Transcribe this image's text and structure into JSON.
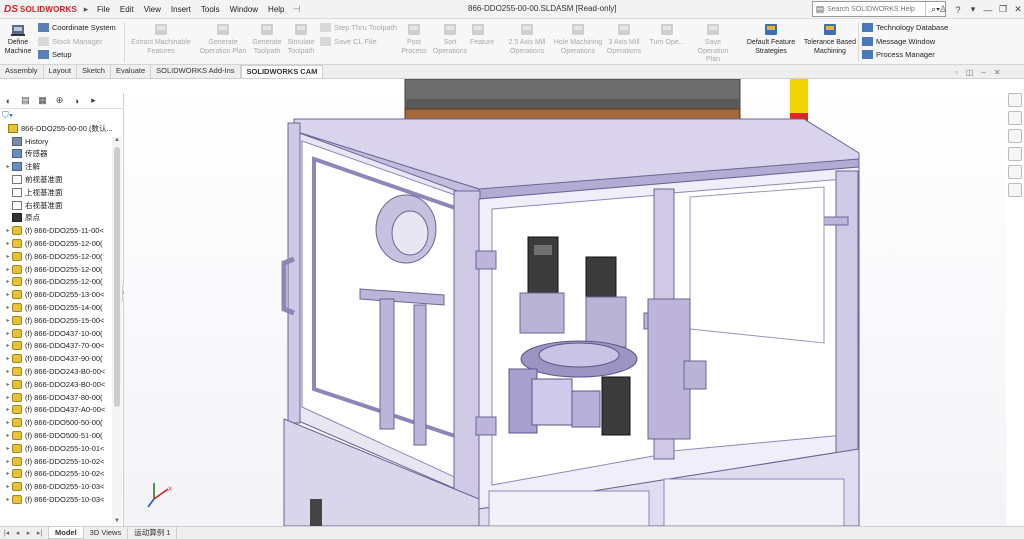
{
  "app": {
    "brand": "SOLIDWORKS",
    "brand_prefix": "DS",
    "document_title": "866-DDO255-00-00.SLDASM [Read-only]",
    "menus": [
      "File",
      "Edit",
      "View",
      "Insert",
      "Tools",
      "Window",
      "Help"
    ],
    "search_placeholder": "Search SOLIDWORKS Help"
  },
  "ribbon": {
    "define_machine": "Define Machine",
    "setup_group": [
      {
        "label": "Coordinate System",
        "enabled": true
      },
      {
        "label": "Stock Manager",
        "enabled": false
      },
      {
        "label": "Setup",
        "enabled": true
      }
    ],
    "buttons": [
      {
        "label": "Extract Machinable Features",
        "enabled": false
      },
      {
        "label": "Generate Operation Plan",
        "enabled": false
      },
      {
        "label": "Generate Toolpath",
        "enabled": false
      },
      {
        "label": "Simulate Toolpath",
        "enabled": false
      }
    ],
    "toolpath_group": [
      {
        "label": "Step Thru Toolpath",
        "enabled": false
      },
      {
        "label": "Save CL File",
        "enabled": false
      }
    ],
    "buttons2": [
      {
        "label": "Post Process",
        "enabled": false
      },
      {
        "label": "Sort Operations",
        "enabled": false
      },
      {
        "label": "Feature",
        "enabled": false
      },
      {
        "label": "2.5 Axis Mill Operations",
        "enabled": false
      },
      {
        "label": "Hole Machining Operations",
        "enabled": false
      },
      {
        "label": "3 Axis Mill Operations",
        "enabled": false
      },
      {
        "label": "Turn Ope...",
        "enabled": false
      },
      {
        "label": "Save Operation Plan",
        "enabled": false
      },
      {
        "label": "Default Feature Strategies",
        "enabled": true
      },
      {
        "label": "Tolerance Based Machining",
        "enabled": true
      }
    ],
    "right_group": [
      {
        "label": "Technology Database"
      },
      {
        "label": "Message Window"
      },
      {
        "label": "Process Manager"
      }
    ]
  },
  "tabs": [
    "Assembly",
    "Layout",
    "Sketch",
    "Evaluate",
    "SOLIDWORKS Add-Ins",
    "SOLIDWORKS CAM"
  ],
  "active_tab": "SOLIDWORKS CAM",
  "feature_tree": {
    "root": "866-DDO255-00-00 (数认...",
    "items": [
      {
        "label": "History",
        "icon": "history-icon",
        "expand": false
      },
      {
        "label": "传感器",
        "icon": "sensor-icon",
        "expand": false
      },
      {
        "label": "注解",
        "icon": "annotation-icon",
        "expand": true
      },
      {
        "label": "前视基准面",
        "icon": "plane-icon",
        "expand": false
      },
      {
        "label": "上视基准面",
        "icon": "plane-icon",
        "expand": false
      },
      {
        "label": "右视基准面",
        "icon": "plane-icon",
        "expand": false
      },
      {
        "label": "原点",
        "icon": "origin-icon",
        "expand": false
      },
      {
        "label": "(f) 866-DDO255-11-00<",
        "icon": "assembly-icon",
        "expand": true
      },
      {
        "label": "(f) 866-DDO255-12-00(",
        "icon": "assembly-icon",
        "expand": true
      },
      {
        "label": "(f) 866-DDO255-12-00(",
        "icon": "assembly-icon",
        "expand": true
      },
      {
        "label": "(f) 866-DDO255-12-00(",
        "icon": "assembly-icon",
        "expand": true
      },
      {
        "label": "(f) 866-DDO255-12-00(",
        "icon": "assembly-icon",
        "expand": true
      },
      {
        "label": "(f) 866-DDO255-13-00<",
        "icon": "assembly-icon",
        "expand": true
      },
      {
        "label": "(f) 866-DDO255-14-00(",
        "icon": "assembly-icon",
        "expand": true
      },
      {
        "label": "(f) 866-DDO255-15-00<",
        "icon": "assembly-icon",
        "expand": true
      },
      {
        "label": "(f) 866-DDO437-10-00(",
        "icon": "assembly-icon",
        "expand": true
      },
      {
        "label": "(f) 866-DDO437-70-00<",
        "icon": "assembly-icon",
        "expand": true
      },
      {
        "label": "(f) 866-DDO437-90-00(",
        "icon": "assembly-icon",
        "expand": true
      },
      {
        "label": "(f) 866-DDO243-B0-00<",
        "icon": "assembly-icon",
        "expand": true
      },
      {
        "label": "(f) 866-DDO243-B0-00<",
        "icon": "assembly-icon",
        "expand": true
      },
      {
        "label": "(f) 866-DDO437-80-00(",
        "icon": "assembly-icon",
        "expand": true
      },
      {
        "label": "(f) 866-DDO437-A0-00<",
        "icon": "assembly-icon",
        "expand": true
      },
      {
        "label": "(f) 866-DDO500-50-00(",
        "icon": "assembly-icon",
        "expand": true
      },
      {
        "label": "(f) 866-DDO500-51-00(",
        "icon": "assembly-icon",
        "expand": true
      },
      {
        "label": "(f) 866-DDO255-10-01<",
        "icon": "assembly-icon",
        "expand": true
      },
      {
        "label": "(f) 866-DDO255-10-02<",
        "icon": "assembly-icon",
        "expand": true
      },
      {
        "label": "(f) 866-DDO255-10-02<",
        "icon": "assembly-icon",
        "expand": true
      },
      {
        "label": "(f) 866-DDO255-10-03<",
        "icon": "assembly-icon",
        "expand": true
      },
      {
        "label": "(f) 866-DDO255-10-03<",
        "icon": "assembly-icon",
        "expand": true
      }
    ]
  },
  "bottom_tabs": [
    "Model",
    "3D Views",
    "运动算例 1"
  ],
  "active_bottom_tab": "Model",
  "colors": {
    "brand_red": "#d61f26",
    "frame_purple": "#bdb5d9",
    "frame_purple_dark": "#8f86b7",
    "cover_gray": "#6b6b6b",
    "plate_brown": "#a4683e"
  }
}
